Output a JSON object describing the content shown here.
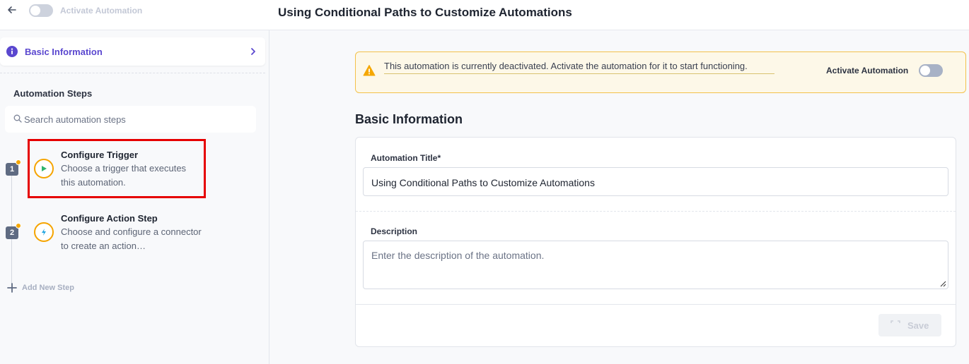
{
  "header": {
    "back_icon": "arrow-left-icon",
    "activate_label": "Activate Automation",
    "activate_on": false,
    "title": "Using Conditional Paths to Customize Automations"
  },
  "sidebar": {
    "basic_info": {
      "label": "Basic Information",
      "icon": "info-icon",
      "accent": "#5a47cf"
    },
    "steps_heading": "Automation Steps",
    "search": {
      "placeholder": "Search automation steps"
    },
    "steps": [
      {
        "number": "1",
        "title": "Configure Trigger",
        "description": "Choose a trigger that executes this automation.",
        "icon": "play-icon",
        "highlighted": true
      },
      {
        "number": "2",
        "title": "Configure Action Step",
        "description": "Choose and configure a connector to create an action…",
        "icon": "lightning-icon",
        "highlighted": false
      }
    ],
    "add_step_label": "Add New Step"
  },
  "main": {
    "alert": {
      "icon": "warning-icon",
      "text": "This automation is currently deactivated. Activate the automation for it to start functioning.",
      "toggle_label": "Activate Automation",
      "toggle_on": false,
      "color": "#f3c14a"
    },
    "section_heading": "Basic Information",
    "form": {
      "title_label": "Automation Title*",
      "title_value": "Using Conditional Paths to Customize Automations",
      "description_label": "Description",
      "description_placeholder": "Enter the description of the automation.",
      "save_label": "Save",
      "save_enabled": false
    }
  }
}
